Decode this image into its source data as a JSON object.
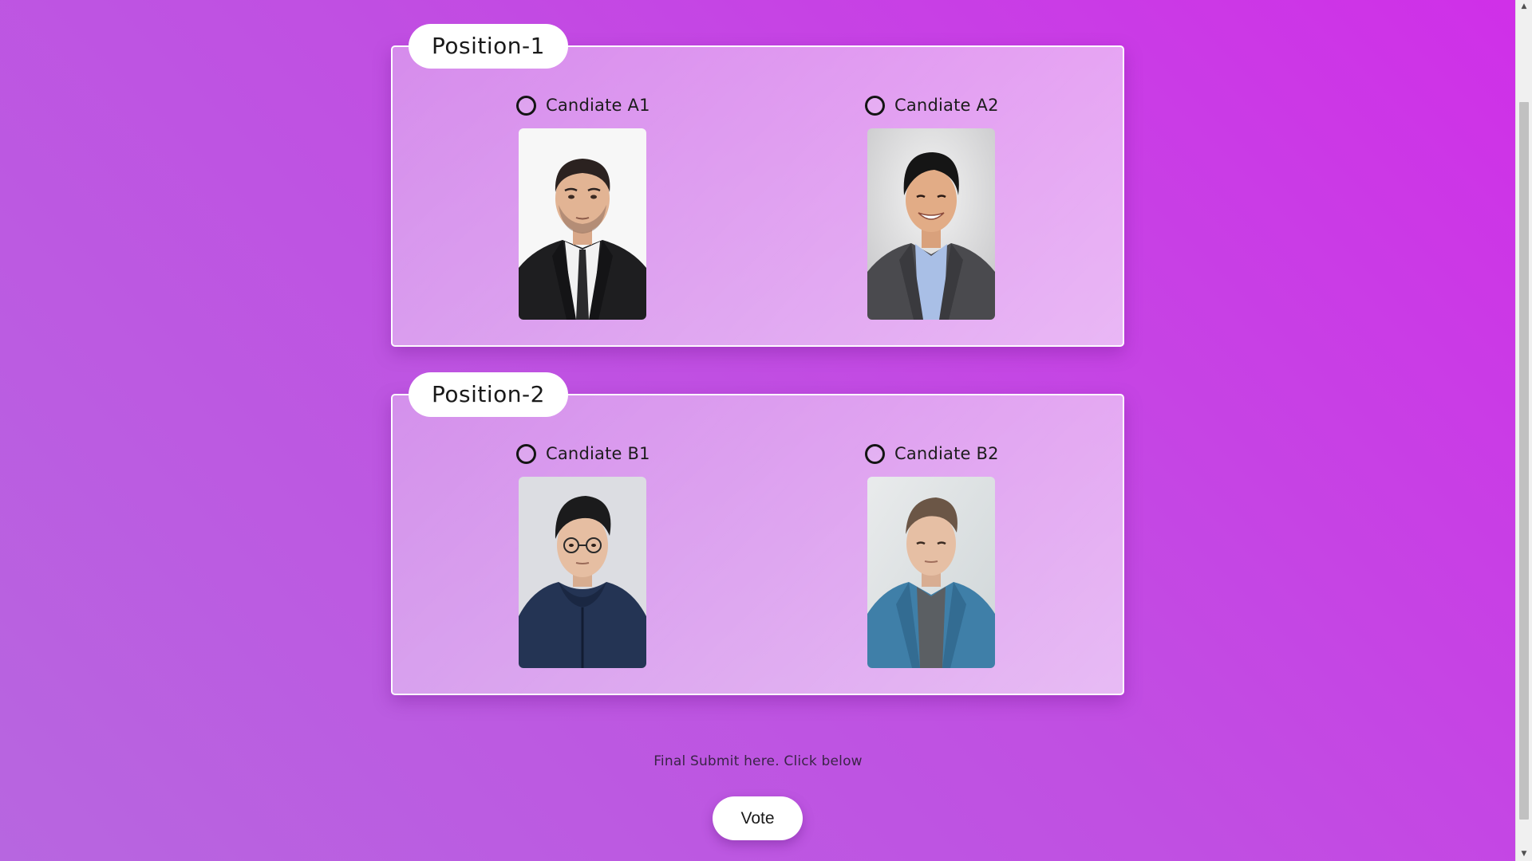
{
  "positions": [
    {
      "title": "Position-1",
      "candidates": [
        {
          "name": "Candiate A1",
          "photo": "candidate-photo-man-dark-suit-white-background",
          "selected": false
        },
        {
          "name": "Candiate A2",
          "photo": "candidate-photo-man-grey-blazer-smiling",
          "selected": false
        }
      ]
    },
    {
      "title": "Position-2",
      "candidates": [
        {
          "name": "Candiate B1",
          "photo": "candidate-photo-man-glasses-navy-hoodie",
          "selected": false
        },
        {
          "name": "Candiate B2",
          "photo": "candidate-photo-man-denim-shirt",
          "selected": false
        }
      ]
    }
  ],
  "submit": {
    "instruction": "Final Submit here. Click below",
    "button_label": "Vote"
  },
  "colors": {
    "background_start": "#b766e0",
    "background_end": "#d02fe8",
    "card_border": "#ffffff",
    "button_bg": "#ffffff"
  },
  "scrollbar": {
    "up_icon": "scroll-up-arrow-icon",
    "down_icon": "scroll-down-arrow-icon"
  }
}
